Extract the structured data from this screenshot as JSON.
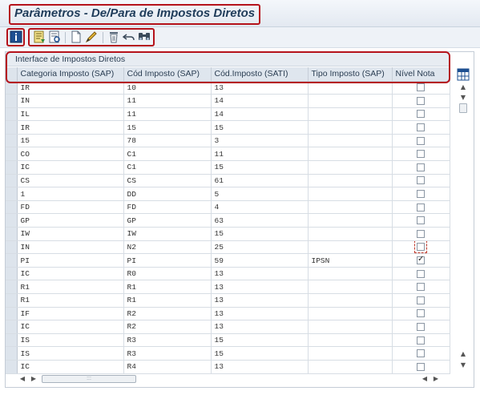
{
  "window": {
    "title": "Parâmetros - De/Para de Impostos Diretos"
  },
  "toolbar": {
    "buttons": [
      {
        "icon": "info-icon"
      },
      {
        "icon": "display-change-icon"
      },
      {
        "icon": "details-icon"
      },
      {
        "icon": "new-entries-icon"
      },
      {
        "icon": "edit-icon"
      },
      {
        "icon": "delete-icon"
      },
      {
        "icon": "undo-icon"
      },
      {
        "icon": "find-icon"
      }
    ]
  },
  "grid": {
    "caption": "Interface de Impostos Diretos",
    "columns": [
      "Categoria Imposto (SAP)",
      "Cód Imposto (SAP)",
      "Cód.Imposto (SATI)",
      "Tipo Imposto (SAP)",
      "Nível Nota"
    ],
    "rows": [
      {
        "cat": "IR",
        "cod": "10",
        "sati": "13",
        "tipo": "",
        "nivel": false
      },
      {
        "cat": "IN",
        "cod": "11",
        "sati": "14",
        "tipo": "",
        "nivel": false
      },
      {
        "cat": "IL",
        "cod": "11",
        "sati": "14",
        "tipo": "",
        "nivel": false
      },
      {
        "cat": "IR",
        "cod": "15",
        "sati": "15",
        "tipo": "",
        "nivel": false
      },
      {
        "cat": "15",
        "cod": "78",
        "sati": "3",
        "tipo": "",
        "nivel": false
      },
      {
        "cat": "CO",
        "cod": "C1",
        "sati": "11",
        "tipo": "",
        "nivel": false
      },
      {
        "cat": "IC",
        "cod": "C1",
        "sati": "15",
        "tipo": "",
        "nivel": false
      },
      {
        "cat": "CS",
        "cod": "CS",
        "sati": "61",
        "tipo": "",
        "nivel": false
      },
      {
        "cat": "1",
        "cod": "DD",
        "sati": "5",
        "tipo": "",
        "nivel": false
      },
      {
        "cat": "FD",
        "cod": "FD",
        "sati": "4",
        "tipo": "",
        "nivel": false
      },
      {
        "cat": "GP",
        "cod": "GP",
        "sati": "63",
        "tipo": "",
        "nivel": false
      },
      {
        "cat": "IW",
        "cod": "IW",
        "sati": "15",
        "tipo": "",
        "nivel": false
      },
      {
        "cat": "IN",
        "cod": "N2",
        "sati": "25",
        "tipo": "",
        "nivel": false
      },
      {
        "cat": "PI",
        "cod": "PI",
        "sati": "59",
        "tipo": "IPSN",
        "nivel": true
      },
      {
        "cat": "IC",
        "cod": "R0",
        "sati": "13",
        "tipo": "",
        "nivel": false
      },
      {
        "cat": "R1",
        "cod": "R1",
        "sati": "13",
        "tipo": "",
        "nivel": false
      },
      {
        "cat": "R1",
        "cod": "R1",
        "sati": "13",
        "tipo": "",
        "nivel": false
      },
      {
        "cat": "IF",
        "cod": "R2",
        "sati": "13",
        "tipo": "",
        "nivel": false
      },
      {
        "cat": "IC",
        "cod": "R2",
        "sati": "13",
        "tipo": "",
        "nivel": false
      },
      {
        "cat": "IS",
        "cod": "R3",
        "sati": "15",
        "tipo": "",
        "nivel": false
      },
      {
        "cat": "IS",
        "cod": "R3",
        "sati": "15",
        "tipo": "",
        "nivel": false
      },
      {
        "cat": "IC",
        "cod": "R4",
        "sati": "13",
        "tipo": "",
        "nivel": false
      }
    ]
  },
  "colors": {
    "highlight": "#b5121b",
    "header_bg": "#dfe6ee",
    "title": "#1f3c5a"
  }
}
